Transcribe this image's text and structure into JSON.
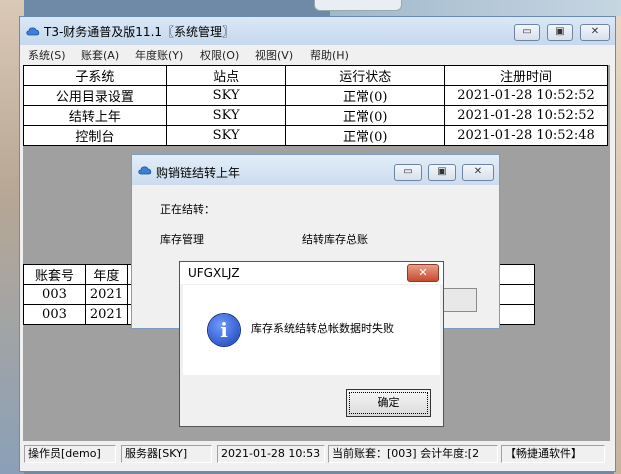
{
  "main_window": {
    "title": "T3-财务通普及版11.1〖系统管理〗",
    "menu": [
      "系统(S)",
      "账套(A)",
      "年度账(Y)",
      "权限(O)",
      "视图(V)",
      "帮助(H)"
    ],
    "subsystem_table": {
      "headers": [
        "子系统",
        "站点",
        "运行状态",
        "注册时间"
      ],
      "rows": [
        [
          "公用目录设置",
          "SKY",
          "正常(0)",
          "2021-01-28 10:52:52"
        ],
        [
          "结转上年",
          "SKY",
          "正常(0)",
          "2021-01-28 10:52:52"
        ],
        [
          "控制台",
          "SKY",
          "正常(0)",
          "2021-01-28 10:52:48"
        ]
      ]
    },
    "account_table": {
      "headers": [
        "账套号",
        "年度"
      ],
      "rows": [
        [
          "003",
          "2021"
        ],
        [
          "003",
          "2021"
        ]
      ]
    },
    "status_bar": {
      "operator": "操作员[demo]",
      "server": "服务器[SKY]",
      "datetime": "2021-01-28 10:53",
      "current": "当前账套：[003] 会计年度:[2",
      "brand": "【畅捷通软件】"
    }
  },
  "sub_dialog": {
    "title": "购销链结转上年",
    "label": "正在结转：",
    "module": "库存管理",
    "task": "结转库存总账"
  },
  "message_box": {
    "title": "UFGXLJZ",
    "message": "库存系统结转总帐数据时失败",
    "ok_label": "确定",
    "close_glyph": "✕"
  }
}
